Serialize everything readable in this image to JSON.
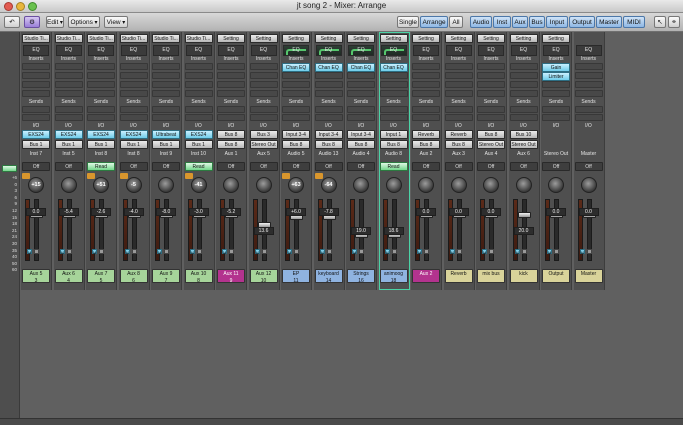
{
  "window": {
    "title": "jt song 2 - Mixer: Arrange"
  },
  "toolbar": {
    "left": [
      {
        "label": "↶",
        "name": "back-button"
      },
      {
        "label": "⚙",
        "name": "link-button"
      },
      {
        "label": "Edit",
        "name": "edit-menu"
      },
      {
        "label": "Options",
        "name": "options-menu"
      },
      {
        "label": "View",
        "name": "view-menu"
      }
    ],
    "view_modes": [
      {
        "label": "Single",
        "active": false
      },
      {
        "label": "Arrange",
        "active": true
      },
      {
        "label": "All",
        "active": false
      }
    ],
    "filters": [
      "Audio",
      "Inst",
      "Aux",
      "Bus",
      "Input",
      "Output",
      "Master",
      "MIDI"
    ]
  },
  "row_labels": {
    "setting": "Setting",
    "eq": "EQ",
    "inserts": "Inserts",
    "sends": "Sends",
    "io": "I/O",
    "off": "Off",
    "read": "Read"
  },
  "scale": [
    "+6",
    "0",
    "3",
    "6",
    "9",
    "12",
    "15",
    "18",
    "21",
    "24",
    "30",
    "35",
    "40",
    "50",
    "60"
  ],
  "strips": [
    {
      "setting": "Studio Ti...",
      "inserts": [],
      "chan_eq": false,
      "input": "EXS24",
      "input_color": "blue",
      "output": "Bus 1",
      "group": "Inst 7",
      "auto": "Off",
      "pan": "+15",
      "vol": "0.0",
      "name": "Aux 5",
      "num": "3",
      "color": "#a6d49a"
    },
    {
      "setting": "Studio Ti...",
      "inserts": [],
      "chan_eq": false,
      "input": "EXS24",
      "input_color": "blue",
      "output": "Bus 1",
      "group": "Inst 5",
      "auto": "Off",
      "pan": "",
      "vol": "-5.4",
      "name": "Aux 6",
      "num": "4",
      "color": "#a6d49a"
    },
    {
      "setting": "Studio Ti...",
      "inserts": [],
      "chan_eq": false,
      "input": "EXS24",
      "input_color": "blue",
      "output": "Bus 1",
      "group": "Inst 8",
      "auto": "Read",
      "pan": "+51",
      "vol": "-2.6",
      "name": "Aux 7",
      "num": "5",
      "color": "#a6d49a"
    },
    {
      "setting": "Studio Ti...",
      "inserts": [],
      "chan_eq": false,
      "input": "EXS24",
      "input_color": "blue",
      "output": "Bus 1",
      "group": "Inst 8",
      "auto": "Off",
      "pan": "-5",
      "vol": "-4.0",
      "name": "Aux 8",
      "num": "6",
      "color": "#a6d49a"
    },
    {
      "setting": "Studio Ti...",
      "inserts": [],
      "chan_eq": false,
      "input": "Ultrabeat",
      "input_color": "blue",
      "output": "Bus 1",
      "group": "Inst 9",
      "auto": "Off",
      "pan": "",
      "vol": "-8.0",
      "name": "Aux 9",
      "num": "7",
      "color": "#a6d49a"
    },
    {
      "setting": "Studio Ti...",
      "inserts": [],
      "chan_eq": false,
      "input": "EXS24",
      "input_color": "blue",
      "output": "Bus 1",
      "group": "Inst 10",
      "auto": "Read",
      "pan": "-41",
      "vol": "-3.0",
      "name": "Aux 10",
      "num": "8",
      "color": "#a6d49a"
    },
    {
      "setting": "Setting",
      "inserts": [],
      "chan_eq": false,
      "input": "Bus 8",
      "input_color": "",
      "output": "Bus 8",
      "group": "Aux 1",
      "auto": "Off",
      "pan": "",
      "vol": "-5.2",
      "name": "Aux 11",
      "num": "9",
      "color": "#b3338e"
    },
    {
      "setting": "Setting",
      "inserts": [],
      "chan_eq": false,
      "input": "Bus 3",
      "input_color": "",
      "output": "Stereo Out",
      "group": "Aux 5",
      "auto": "Off",
      "pan": "",
      "vol": "13.6",
      "name": "Aux 12",
      "num": "10",
      "color": "#a6d49a"
    },
    {
      "setting": "Setting",
      "inserts": [
        "Chan EQ"
      ],
      "chan_eq": true,
      "input": "Input 3-4",
      "input_color": "",
      "output": "Bus 8",
      "group": "Audio 5",
      "auto": "Off",
      "pan": "+63",
      "vol": "+6.0",
      "name": "EP",
      "num": "11",
      "color": "#8fb3e0"
    },
    {
      "setting": "Setting",
      "inserts": [
        "Chan EQ"
      ],
      "chan_eq": true,
      "input": "Input 3-4",
      "input_color": "",
      "output": "Bus 8",
      "group": "Audio 13",
      "auto": "Off",
      "pan": "-64",
      "vol": "-7.8",
      "name": "keyboard",
      "num": "14",
      "color": "#8fb3e0"
    },
    {
      "setting": "Setting",
      "inserts": [
        "Chan EQ"
      ],
      "chan_eq": true,
      "input": "Input 3-4",
      "input_color": "",
      "output": "Bus 8",
      "group": "Audio 4",
      "auto": "Off",
      "pan": "",
      "vol": "19.0",
      "name": "Strings",
      "num": "16",
      "color": "#8fb3e0"
    },
    {
      "setting": "Setting",
      "inserts": [
        "Chan EQ"
      ],
      "chan_eq": true,
      "input": "Input 1",
      "input_color": "",
      "output": "Bus 8",
      "group": "Audio 8",
      "auto": "Read",
      "pan": "",
      "vol": "18.6",
      "name": "animoog",
      "num": "18",
      "color": "#8fb3e0"
    },
    {
      "setting": "Setting",
      "inserts": [],
      "chan_eq": false,
      "input": "Reverb",
      "input_color": "",
      "output": "Bus 8",
      "group": "Aux 2",
      "auto": "Off",
      "pan": "",
      "vol": "0.0",
      "name": "Aux 2",
      "num": "",
      "color": "#b3338e"
    },
    {
      "setting": "Setting",
      "inserts": [],
      "chan_eq": false,
      "input": "Reverb",
      "input_color": "",
      "output": "Bus 8",
      "group": "Aux 3",
      "auto": "Off",
      "pan": "",
      "vol": "0.0",
      "name": "Reverb",
      "num": "",
      "color": "#d9d39a"
    },
    {
      "setting": "Setting",
      "inserts": [],
      "chan_eq": false,
      "input": "Bus 8",
      "input_color": "",
      "output": "Stereo Out",
      "group": "Aux 4",
      "auto": "Off",
      "pan": "",
      "vol": "0.0",
      "name": "mix bus",
      "num": "",
      "color": "#d9d39a"
    },
    {
      "setting": "Setting",
      "inserts": [],
      "chan_eq": false,
      "input": "Bus 10",
      "input_color": "",
      "output": "Stereo Out",
      "group": "Aux 6",
      "auto": "Off",
      "pan": "",
      "vol": "20.0",
      "name": "kick",
      "num": "",
      "color": "#d9d39a"
    },
    {
      "setting": "Setting",
      "inserts": [
        "Gain",
        "Limiter"
      ],
      "chan_eq": false,
      "input": "",
      "input_color": "",
      "output": "",
      "group": "Stereo Out",
      "auto": "Off",
      "pan": "",
      "vol": "0.0",
      "name": "Output",
      "num": "",
      "color": "#d9d39a"
    },
    {
      "setting": "",
      "inserts": [],
      "chan_eq": false,
      "input": "",
      "input_color": "",
      "output": "",
      "group": "Master",
      "auto": "Off",
      "pan": "",
      "vol": "0.0",
      "name": "Master",
      "num": "",
      "color": "#d9d39a"
    }
  ]
}
